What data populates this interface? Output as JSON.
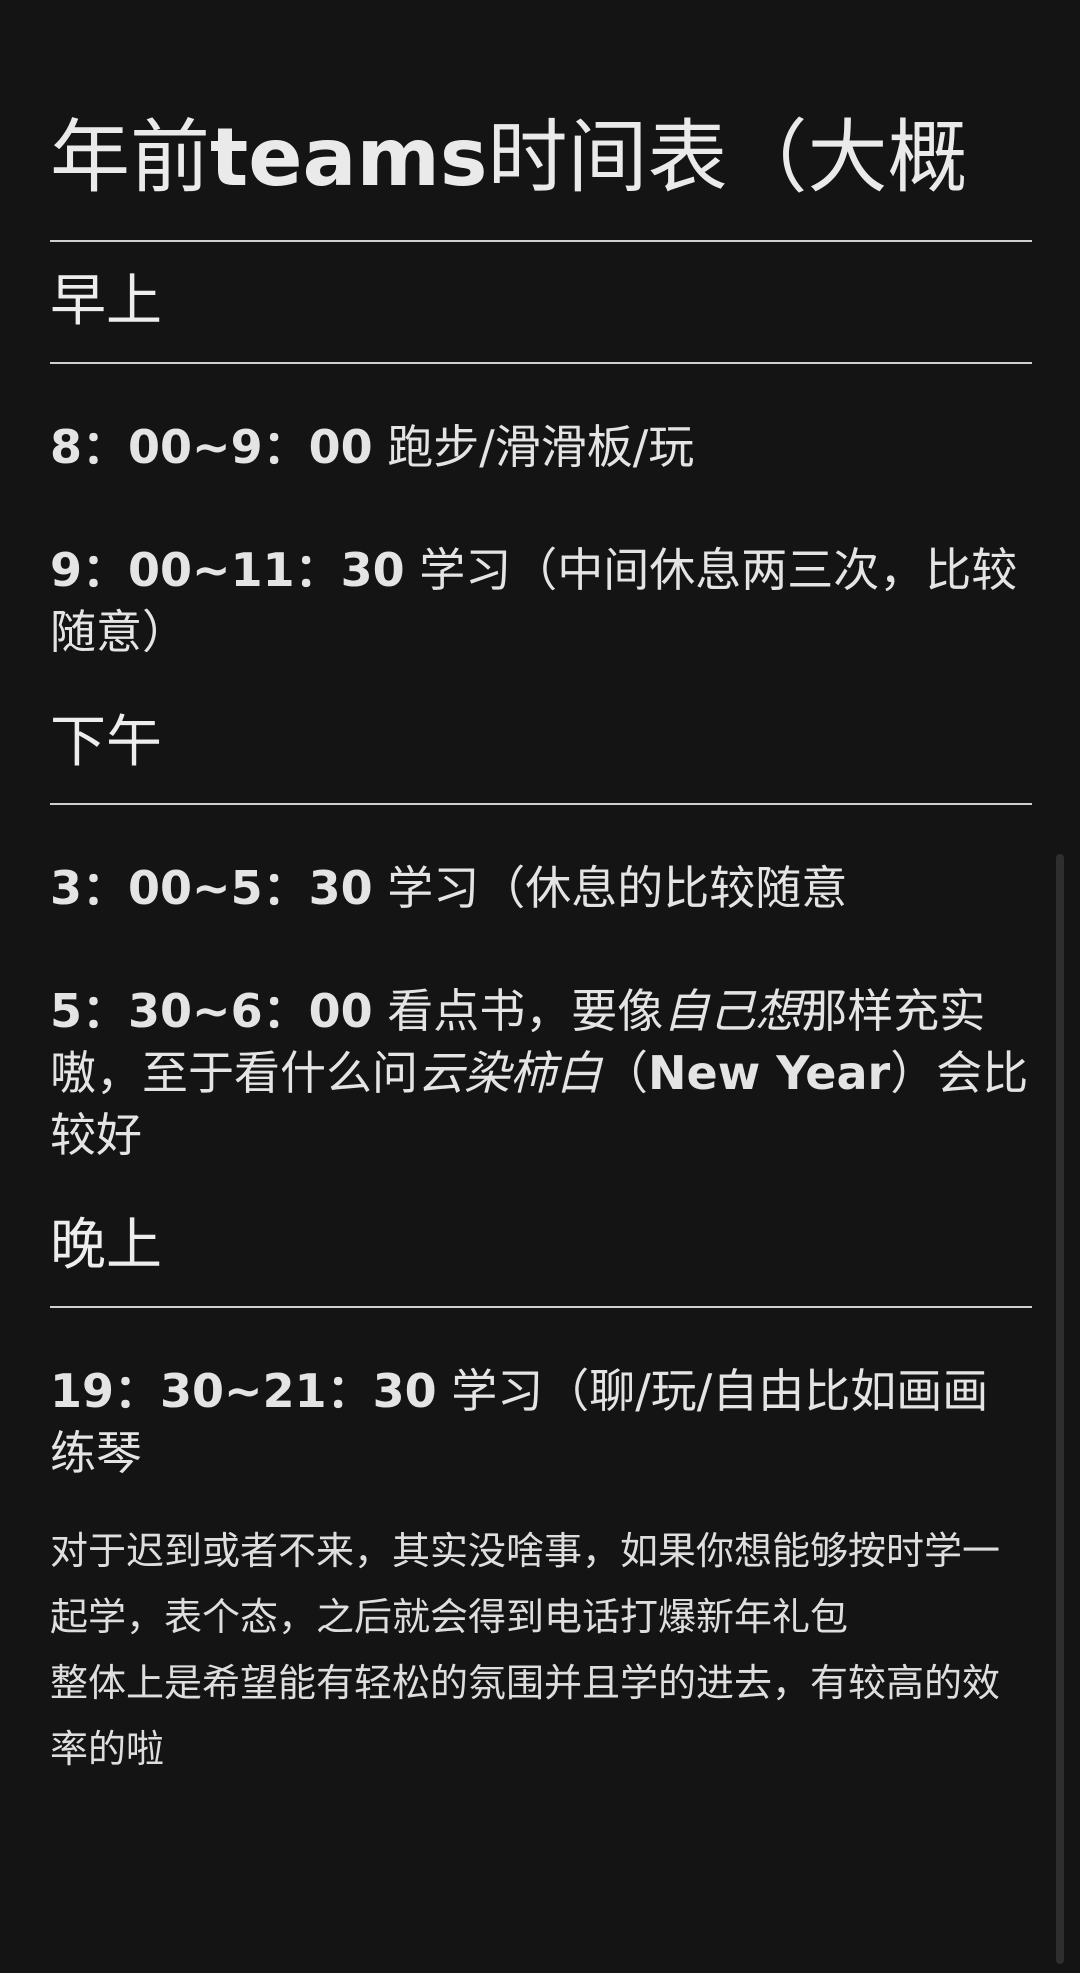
{
  "title": {
    "part1": "年前",
    "part2": "teams",
    "part3": "时间表（大概"
  },
  "sections": {
    "morning": {
      "heading": "早上",
      "entries": [
        {
          "time": "8：00~9：00",
          "text": " 跑步/滑滑板/玩"
        },
        {
          "time": "9：00~11：30",
          "text": " 学习（中间休息两三次，比较随意）"
        }
      ]
    },
    "afternoon": {
      "heading": "下午",
      "entry1": {
        "time": "3：00~5：30",
        "text": " 学习（休息的比较随意"
      },
      "entry2": {
        "time": "5：30~6：00",
        "text_a": " 看点书，要像",
        "em_a": "自己想",
        "text_b": "那样充实嗷，至于看什么问",
        "em_b": "云染柿白",
        "text_c": "（",
        "bold_c": "New Year",
        "text_d": "）会比较好"
      }
    },
    "evening": {
      "heading": "晚上",
      "entry": {
        "time": "19：30~21：30",
        "text": " 学习（聊/玩/自由比如画画练琴"
      }
    }
  },
  "notes": {
    "line1": "对于迟到或者不来，其实没啥事，如果你想能够按时学一起学，表个态，之后就会得到电话打爆新年礼包",
    "line2": "整体上是希望能有轻松的氛围并且学的进去，有较高的效率的啦"
  }
}
